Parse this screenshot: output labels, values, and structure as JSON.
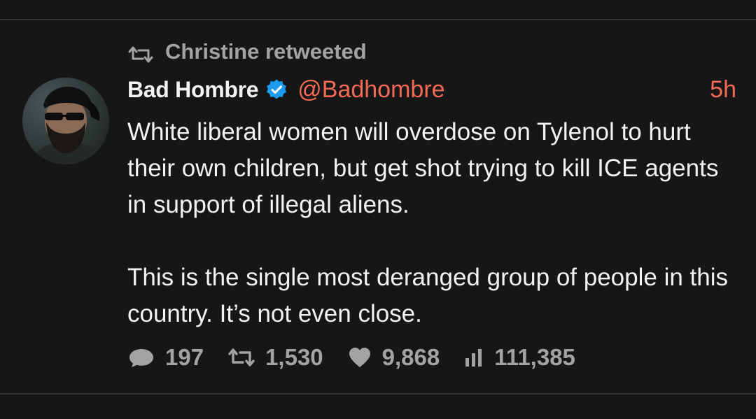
{
  "retweet": {
    "icon": "retweet-icon",
    "text": "Christine retweeted"
  },
  "author": {
    "name": "Bad Hombre",
    "verified_icon": "verified-badge-icon",
    "handle": "@Badhombre",
    "time": "5h"
  },
  "tweet": {
    "paragraphs": [
      "White liberal women will overdose on Tylenol to hurt their own children, but get shot trying to kill ICE agents in support of illegal aliens.",
      "This is the single most deranged group of people in this country. It’s not even close."
    ]
  },
  "stats": {
    "replies": {
      "icon": "reply-bubble-icon",
      "value": "197"
    },
    "retweets": {
      "icon": "retweet-icon",
      "value": "1,530"
    },
    "likes": {
      "icon": "heart-icon",
      "value": "9,868"
    },
    "views": {
      "icon": "bar-chart-icon",
      "value": "111,385"
    }
  },
  "colors": {
    "background": "#161616",
    "text": "#f2f2f2",
    "muted": "#a3a3a3",
    "accent": "#f26a55",
    "verified": "#1d9bf0"
  }
}
